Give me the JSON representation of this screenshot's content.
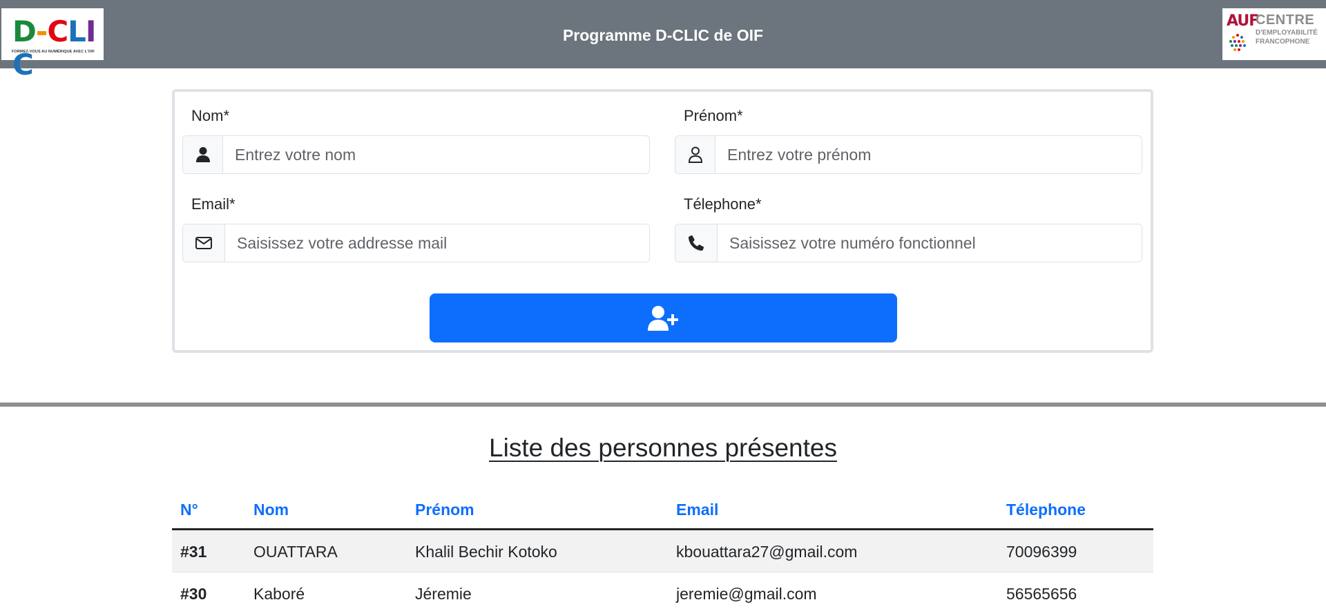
{
  "header": {
    "title": "Programme D-CLIC de OIF",
    "left_logo": {
      "letters": [
        "D",
        "-",
        "C",
        "L",
        "I",
        "C"
      ],
      "letter_colors": [
        "#1a8a3a",
        "#f39200",
        "#e30613",
        "#1d71b8",
        "#6f2c91",
        "#1d71b8"
      ],
      "tagline": "FORMEZ-VOUS AU NUMÉRIQUE AVEC L'OIF"
    },
    "right_logo": {
      "brand": "AUF",
      "line1": "CENTRE",
      "line2": "D'EMPLOYABILITÉ",
      "line3": "FRANCOPHONE"
    }
  },
  "form": {
    "nom": {
      "label": "Nom*",
      "placeholder": "Entrez votre nom",
      "icon": "user-solid-icon"
    },
    "prenom": {
      "label": "Prénom*",
      "placeholder": "Entrez votre prénom",
      "icon": "user-outline-icon"
    },
    "email": {
      "label": "Email*",
      "placeholder": "Saisissez votre addresse mail",
      "icon": "envelope-icon"
    },
    "telephone": {
      "label": "Télephone*",
      "placeholder": "Saisissez votre numéro fonctionnel",
      "icon": "phone-icon"
    },
    "submit_icon": "user-plus-icon"
  },
  "list": {
    "title": "Liste des personnes présentes",
    "columns": [
      "N°",
      "Nom",
      "Prénom",
      "Email",
      "Télephone"
    ],
    "rows": [
      {
        "num": "#31",
        "nom": "OUATTARA",
        "prenom": "Khalil Bechir Kotoko",
        "email": "kbouattara27@gmail.com",
        "telephone": "70096399"
      },
      {
        "num": "#30",
        "nom": "Kaboré",
        "prenom": "Jéremie",
        "email": "jeremie@gmail.com",
        "telephone": "56565656"
      }
    ]
  },
  "colors": {
    "header_bg": "#6c757d",
    "primary": "#0d6efd",
    "divider": "#8f8f8f"
  }
}
